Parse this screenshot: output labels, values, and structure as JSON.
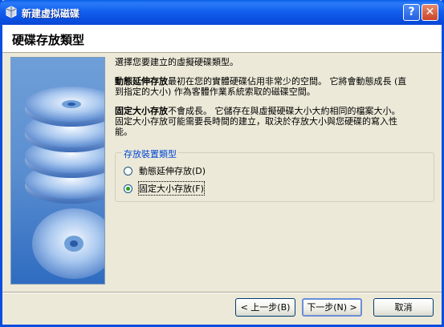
{
  "window": {
    "title": "新建虚拟磁碟",
    "help": "?",
    "close": "✕"
  },
  "header": {
    "title": "硬碟存放類型"
  },
  "intro": "選擇您要建立的虛擬硬碟類型。",
  "dynamic": {
    "bold": "動態延伸存放",
    "line1": "最初在您的實體硬碟佔用非常少的空間。 它將會動態成長 (直",
    "line2": "到指定的大小) 作為客體作業系統索取的磁碟空間。"
  },
  "fixed": {
    "bold": "固定大小存放",
    "line1": "不會成長。 它儲存在與虛擬硬碟大小大約相同的檔案大小。",
    "line2": "固定大小存放可能需要長時間的建立，取決於存放大小與您硬碟的寫入性",
    "line3": "能。"
  },
  "storage_group": {
    "legend": "存放裝置類型",
    "options": [
      {
        "label": "動態延伸存放(D)",
        "checked": false
      },
      {
        "label": "固定大小存放(F)",
        "checked": true
      }
    ]
  },
  "buttons": {
    "back": "< 上一步(B)",
    "next": "下一步(N) >",
    "cancel": "取消"
  },
  "colors": {
    "titlebar": "#0a4fe0",
    "accent": "#0046d5"
  }
}
